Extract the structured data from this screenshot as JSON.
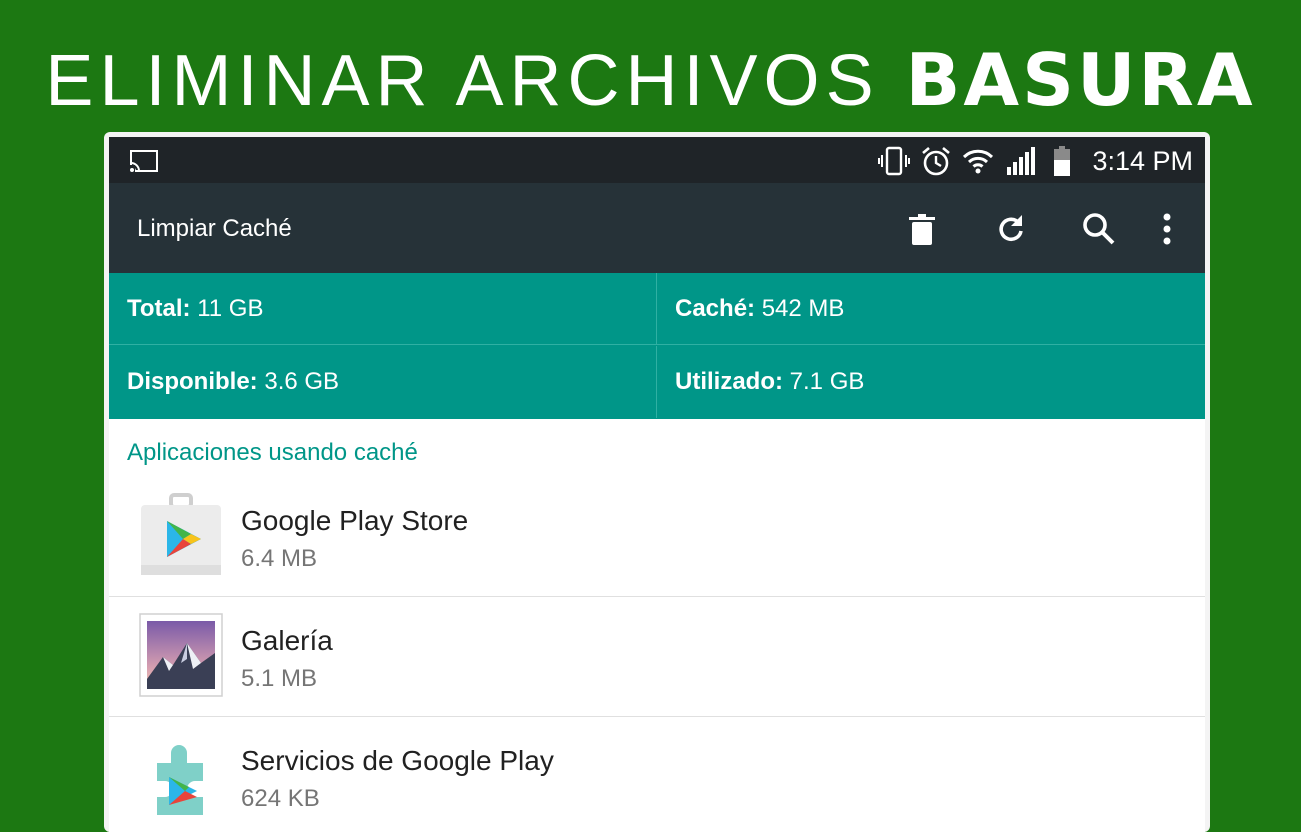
{
  "headline": {
    "light": "ELIMINAR ARCHIVOS",
    "bold": "BASURA"
  },
  "statusbar": {
    "time": "3:14 PM",
    "icons": [
      "cast-icon",
      "vibrate-icon",
      "alarm-icon",
      "wifi-icon",
      "signal-icon",
      "battery-icon"
    ]
  },
  "toolbar": {
    "title": "Limpiar Caché",
    "actions": [
      "delete-icon",
      "refresh-icon",
      "search-icon",
      "more-vert-icon"
    ]
  },
  "stats": {
    "total_label": "Total:",
    "total_value": " 11 GB",
    "cache_label": "Caché:",
    "cache_value": " 542 MB",
    "available_label": "Disponible:",
    "available_value": " 3.6 GB",
    "used_label": "Utilizado:",
    "used_value": " 7.1 GB"
  },
  "section": {
    "title": "Aplicaciones usando caché"
  },
  "apps": [
    {
      "name": "Google Play Store",
      "size": "6.4 MB",
      "icon": "play-store-icon"
    },
    {
      "name": "Galería",
      "size": "5.1 MB",
      "icon": "gallery-icon"
    },
    {
      "name": "Servicios de Google Play",
      "size": "624 KB",
      "icon": "play-services-icon"
    }
  ],
  "colors": {
    "background": "#1c7812",
    "toolbar": "#263238",
    "statusbar": "#1f2428",
    "accent": "#009688"
  }
}
